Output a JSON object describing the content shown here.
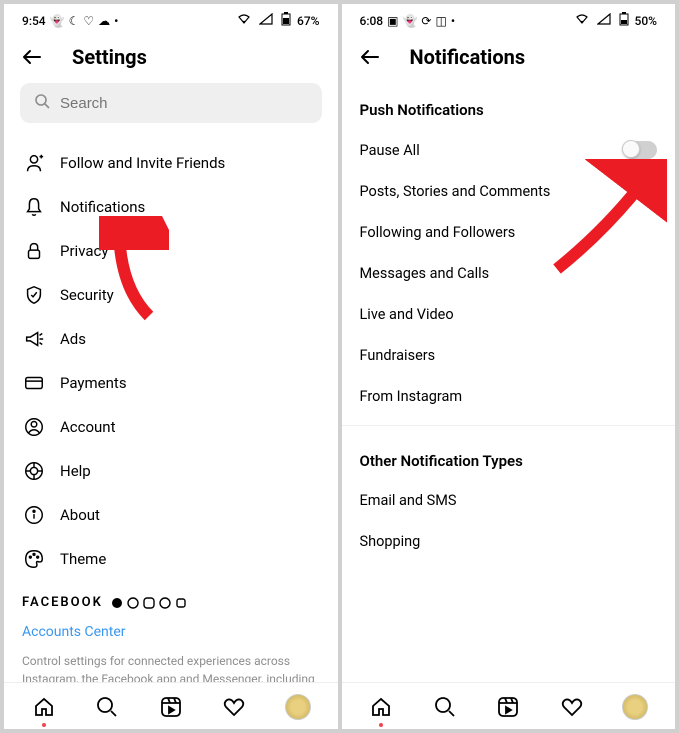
{
  "left": {
    "status": {
      "time": "9:54",
      "battery": "67%"
    },
    "title": "Settings",
    "search_placeholder": "Search",
    "menu": [
      {
        "label": "Follow and Invite Friends"
      },
      {
        "label": "Notifications"
      },
      {
        "label": "Privacy"
      },
      {
        "label": "Security"
      },
      {
        "label": "Ads"
      },
      {
        "label": "Payments"
      },
      {
        "label": "Account"
      },
      {
        "label": "Help"
      },
      {
        "label": "About"
      },
      {
        "label": "Theme"
      }
    ],
    "brand": "FACEBOOK",
    "accounts_center": "Accounts Center",
    "description": "Control settings for connected experiences across Instagram, the Facebook app and Messenger, including"
  },
  "right": {
    "status": {
      "time": "6:08",
      "battery": "50%"
    },
    "title": "Notifications",
    "section1": "Push Notifications",
    "items1": [
      {
        "label": "Pause All",
        "toggle": true
      },
      {
        "label": "Posts, Stories and Comments"
      },
      {
        "label": "Following and Followers"
      },
      {
        "label": "Messages and Calls"
      },
      {
        "label": "Live and Video"
      },
      {
        "label": "Fundraisers"
      },
      {
        "label": "From Instagram"
      }
    ],
    "section2": "Other Notification Types",
    "items2": [
      {
        "label": "Email and SMS"
      },
      {
        "label": "Shopping"
      }
    ]
  }
}
